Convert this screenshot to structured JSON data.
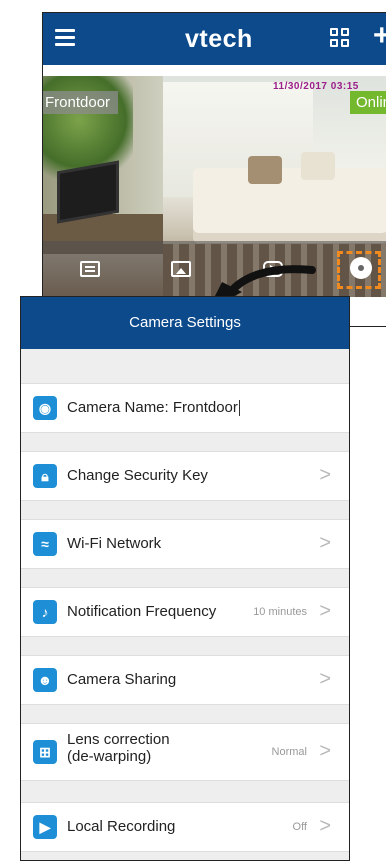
{
  "main_screen": {
    "brand": "vtech",
    "camera": {
      "name": "Frontdoor",
      "timestamp": "11/30/2017 03:15",
      "status": "Onlin"
    },
    "icons": {
      "menu": "hamburger-icon",
      "grid": "grid-icon",
      "add": "plus-icon",
      "settings": "gear-icon"
    }
  },
  "settings_screen": {
    "title": "Camera Settings",
    "items": [
      {
        "label": "Camera Name: Frontdoor",
        "value": "",
        "icon": "camera-icon",
        "chevron": false
      },
      {
        "label": "Change Security Key",
        "value": "",
        "icon": "lock-icon",
        "chevron": true
      },
      {
        "label": "Wi-Fi Network",
        "value": "",
        "icon": "wifi-icon",
        "chevron": true
      },
      {
        "label": "Notification Frequency",
        "value": "10 minutes",
        "icon": "bell-icon",
        "chevron": true
      },
      {
        "label": "Camera Sharing",
        "value": "",
        "icon": "people-icon",
        "chevron": true
      },
      {
        "label": "Lens correction\n(de-warping)",
        "value": "Normal",
        "icon": "lens-icon",
        "chevron": true
      },
      {
        "label": "Local Recording",
        "value": "Off",
        "icon": "video-icon",
        "chevron": true
      }
    ]
  },
  "colors": {
    "header_blue": "#0c4a8c",
    "icon_blue": "#1e8fd6",
    "online_green": "#74b82e",
    "highlight_orange": "#f08a1e"
  }
}
